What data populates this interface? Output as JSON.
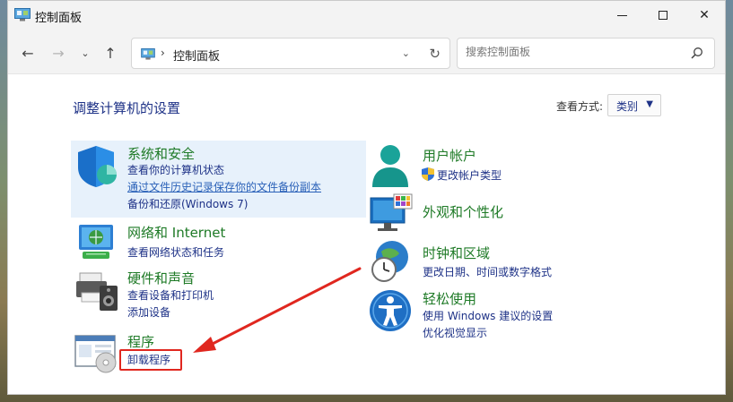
{
  "window": {
    "title": "控制面板",
    "minimize_icon": "minimize-icon",
    "maximize_icon": "maximize-icon",
    "close_icon": "close-icon",
    "close_glyph": "✕"
  },
  "nav": {
    "back": "←",
    "forward": "→",
    "recent": "⌄",
    "up": "↑"
  },
  "address": {
    "separator": "›",
    "path": "控制面板",
    "dropdown": "⌄",
    "refresh": "↻"
  },
  "search": {
    "placeholder": "搜索控制面板"
  },
  "content": {
    "heading": "调整计算机的设置",
    "view_label": "查看方式:",
    "view_value": "类别",
    "view_caret": "▼"
  },
  "categories": {
    "system": {
      "title": "系统和安全",
      "links": [
        "查看你的计算机状态",
        "通过文件历史记录保存你的文件备份副本",
        "备份和还原(Windows 7)"
      ]
    },
    "network": {
      "title": "网络和 Internet",
      "links": [
        "查看网络状态和任务"
      ]
    },
    "hardware": {
      "title": "硬件和声音",
      "links": [
        "查看设备和打印机",
        "添加设备"
      ]
    },
    "programs": {
      "title": "程序",
      "links": [
        "卸载程序"
      ]
    },
    "users": {
      "title": "用户帐户",
      "links": [
        "更改帐户类型"
      ]
    },
    "appearance": {
      "title": "外观和个性化",
      "links": []
    },
    "clock": {
      "title": "时钟和区域",
      "links": [
        "更改日期、时间或数字格式"
      ]
    },
    "access": {
      "title": "轻松使用",
      "links": [
        "使用 Windows 建议的设置",
        "优化视觉显示"
      ]
    }
  },
  "colors": {
    "title_green": "#1e7a26",
    "link_blue": "#1e3287",
    "highlight_bg": "#e7f1fb",
    "annotation_red": "#e0271f"
  }
}
